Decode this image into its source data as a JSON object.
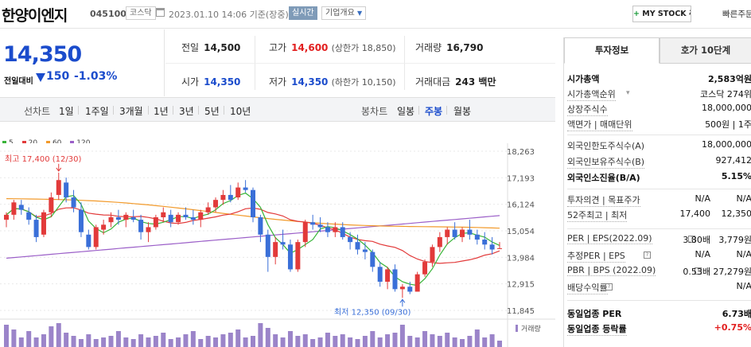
{
  "header": {
    "name": "한양이엔지",
    "code": "045100",
    "market": "코스닥",
    "datetime": "2023.01.10 14:06 기준(장중)",
    "realtime": "실시간",
    "company": "기업개요",
    "mystock": "MY STOCK 추가",
    "quick": "빠른주문"
  },
  "price": {
    "current": "14,350",
    "label": "전일대비",
    "change": "150",
    "rate": "-1.03%"
  },
  "quote": {
    "prev_label": "전일",
    "prev": "14,500",
    "high_label": "고가",
    "high": "14,600",
    "upper": "(상한가 18,850)",
    "vol_label": "거래량",
    "vol": "16,790",
    "open_label": "시가",
    "open": "14,350",
    "low_label": "저가",
    "low": "14,350",
    "lower": "(하한가 10,150)",
    "amt_label": "거래대금",
    "amt": "243 백만"
  },
  "toolbar": {
    "line": "선차트",
    "periods": [
      "1일",
      "1주일",
      "3개월",
      "1년",
      "3년",
      "5년",
      "10년"
    ],
    "candle": "봉차트",
    "cperiods": [
      "일봉",
      "주봉",
      "월봉"
    ],
    "active": "주봉"
  },
  "chart_data": {
    "type": "candlestick",
    "legend": [
      "5",
      "20",
      "60",
      "120"
    ],
    "legend_colors": [
      "#38b438",
      "#e23a3a",
      "#f29a2b",
      "#9b5fc8"
    ],
    "y_ticks": [
      "18,263",
      "17,193",
      "16,124",
      "15,054",
      "13,984",
      "12,915",
      "11,845"
    ],
    "ylim": [
      11845,
      18263
    ],
    "high_annot": "최고 17,400 (12/30)",
    "low_annot": "최저 12,350 (09/30)",
    "volume_label": "거래량",
    "up_color": "#e23a3a",
    "down_color": "#3a6fd8",
    "candles": [
      [
        15500,
        15800,
        15200,
        15700
      ],
      [
        15700,
        16300,
        15500,
        16200
      ],
      [
        16100,
        16300,
        15700,
        15900
      ],
      [
        15800,
        16000,
        15300,
        15500
      ],
      [
        15500,
        15700,
        14600,
        14800
      ],
      [
        14900,
        15900,
        14800,
        15800
      ],
      [
        15800,
        16600,
        15600,
        16400
      ],
      [
        16500,
        17400,
        16300,
        17100
      ],
      [
        17000,
        17200,
        16200,
        16400
      ],
      [
        16400,
        16700,
        15800,
        16000
      ],
      [
        15900,
        16200,
        14800,
        15000
      ],
      [
        14900,
        15100,
        14300,
        14400
      ],
      [
        14400,
        15300,
        14300,
        15200
      ],
      [
        15100,
        15500,
        14900,
        15300
      ],
      [
        15400,
        15800,
        15200,
        15600
      ],
      [
        15600,
        15900,
        15300,
        15500
      ],
      [
        15500,
        15800,
        15200,
        15700
      ],
      [
        15600,
        15900,
        15400,
        15500
      ],
      [
        15500,
        15700,
        14700,
        15000
      ],
      [
        15000,
        15400,
        14600,
        15200
      ],
      [
        15200,
        15700,
        15100,
        15600
      ],
      [
        15600,
        16000,
        15400,
        15800
      ],
      [
        15700,
        15900,
        15200,
        15400
      ],
      [
        15400,
        15800,
        15300,
        15700
      ],
      [
        15700,
        16000,
        15500,
        15600
      ],
      [
        15600,
        15900,
        15300,
        15500
      ],
      [
        15500,
        15900,
        15200,
        15800
      ],
      [
        15800,
        16200,
        15700,
        16000
      ],
      [
        16000,
        16400,
        15800,
        16300
      ],
      [
        16300,
        16700,
        16100,
        16500
      ],
      [
        16500,
        16900,
        16200,
        16300
      ],
      [
        16400,
        17000,
        16300,
        16800
      ],
      [
        16800,
        17100,
        16600,
        16700
      ],
      [
        16700,
        16800,
        15400,
        15600
      ],
      [
        15600,
        15700,
        14600,
        14900
      ],
      [
        14900,
        15100,
        13400,
        14000
      ],
      [
        14000,
        14800,
        13700,
        14600
      ],
      [
        14600,
        15100,
        14300,
        14500
      ],
      [
        14500,
        14700,
        13400,
        13500
      ],
      [
        13500,
        14700,
        13400,
        14600
      ],
      [
        14600,
        15500,
        14400,
        15400
      ],
      [
        15400,
        15700,
        15100,
        15300
      ],
      [
        15300,
        15600,
        15000,
        15200
      ],
      [
        15200,
        15400,
        14800,
        15000
      ],
      [
        15000,
        15400,
        14800,
        15200
      ],
      [
        15200,
        15400,
        14700,
        14800
      ],
      [
        14800,
        15000,
        14300,
        14600
      ],
      [
        14600,
        14900,
        14100,
        14300
      ],
      [
        14300,
        14600,
        13900,
        14200
      ],
      [
        14200,
        14300,
        13400,
        13600
      ],
      [
        13600,
        13800,
        12800,
        13000
      ],
      [
        13000,
        13600,
        12700,
        13500
      ],
      [
        13500,
        13700,
        12600,
        12700
      ],
      [
        12700,
        12900,
        12350,
        12800
      ],
      [
        12800,
        13000,
        12500,
        12600
      ],
      [
        12600,
        13400,
        12600,
        13300
      ],
      [
        13300,
        13900,
        13200,
        13800
      ],
      [
        13800,
        14500,
        13600,
        14400
      ],
      [
        14400,
        15000,
        14200,
        14800
      ],
      [
        14800,
        15200,
        14500,
        15100
      ],
      [
        15100,
        15400,
        14700,
        14800
      ],
      [
        14800,
        15200,
        14600,
        15100
      ],
      [
        15100,
        15500,
        14700,
        14900
      ],
      [
        14900,
        15100,
        14500,
        14700
      ],
      [
        14700,
        15000,
        14300,
        14500
      ],
      [
        14500,
        14800,
        14100,
        14300
      ],
      [
        14350,
        14600,
        14350,
        14350
      ]
    ],
    "volumes": [
      28,
      22,
      12,
      20,
      12,
      16,
      26,
      30,
      18,
      14,
      10,
      16,
      10,
      12,
      14,
      20,
      12,
      10,
      16,
      12,
      14,
      18,
      10,
      12,
      16,
      20,
      10,
      14,
      12,
      16,
      18,
      22,
      12,
      14,
      30,
      24,
      16,
      12,
      20,
      14,
      16,
      10,
      12,
      18,
      14,
      16,
      12,
      10,
      14,
      20,
      12,
      16,
      18,
      28,
      14,
      12,
      20,
      16,
      14,
      18,
      12,
      10,
      14,
      22,
      12,
      16,
      8
    ]
  },
  "side": {
    "tab_on": "투자정보",
    "tab_off": "호가 10단계",
    "rows": [
      {
        "l": "시가총액",
        "v": "2,583억원"
      },
      {
        "l": "시가총액순위",
        "v": "코스닥 274위"
      },
      {
        "l": "상장주식수",
        "v": "18,000,000"
      },
      {
        "l": "액면가 | 매매단위",
        "v": "500원 | 1주"
      },
      {
        "l": "외국인한도주식수(A)",
        "v": "18,000,000"
      },
      {
        "l": "외국인보유주식수(B)",
        "v": "927,412"
      },
      {
        "l": "외국인소진율(B/A)",
        "v": "5.15%"
      },
      {
        "l": "투자의견 | 목표주가",
        "v1": "N/A",
        "v": "N/A"
      },
      {
        "l": "52주최고 | 최저",
        "v1": "17,400",
        "v": "12,350"
      },
      {
        "l": "PER | EPS(2022.09)",
        "v1": "3.80배",
        "v": "3,779원"
      },
      {
        "l": "추정PER | EPS",
        "v1": "N/A",
        "v": "N/A"
      },
      {
        "l": "PBR | BPS (2022.09)",
        "v1": "0.53배",
        "v": "27,279원"
      },
      {
        "l": "배당수익률",
        "v": "N/A"
      },
      {
        "l": "동일업종 PER",
        "v": "6.73배"
      },
      {
        "l": "동일업종 등락률",
        "v": "+0.75%"
      }
    ]
  }
}
